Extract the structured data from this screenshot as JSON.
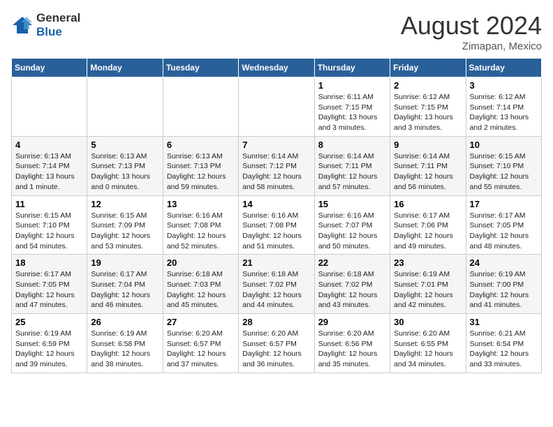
{
  "logo": {
    "text_general": "General",
    "text_blue": "Blue"
  },
  "title": {
    "month_year": "August 2024",
    "location": "Zimapan, Mexico"
  },
  "headers": [
    "Sunday",
    "Monday",
    "Tuesday",
    "Wednesday",
    "Thursday",
    "Friday",
    "Saturday"
  ],
  "weeks": [
    [
      {
        "day": "",
        "info": ""
      },
      {
        "day": "",
        "info": ""
      },
      {
        "day": "",
        "info": ""
      },
      {
        "day": "",
        "info": ""
      },
      {
        "day": "1",
        "info": "Sunrise: 6:11 AM\nSunset: 7:15 PM\nDaylight: 13 hours\nand 3 minutes."
      },
      {
        "day": "2",
        "info": "Sunrise: 6:12 AM\nSunset: 7:15 PM\nDaylight: 13 hours\nand 3 minutes."
      },
      {
        "day": "3",
        "info": "Sunrise: 6:12 AM\nSunset: 7:14 PM\nDaylight: 13 hours\nand 2 minutes."
      }
    ],
    [
      {
        "day": "4",
        "info": "Sunrise: 6:13 AM\nSunset: 7:14 PM\nDaylight: 13 hours\nand 1 minute."
      },
      {
        "day": "5",
        "info": "Sunrise: 6:13 AM\nSunset: 7:13 PM\nDaylight: 13 hours\nand 0 minutes."
      },
      {
        "day": "6",
        "info": "Sunrise: 6:13 AM\nSunset: 7:13 PM\nDaylight: 12 hours\nand 59 minutes."
      },
      {
        "day": "7",
        "info": "Sunrise: 6:14 AM\nSunset: 7:12 PM\nDaylight: 12 hours\nand 58 minutes."
      },
      {
        "day": "8",
        "info": "Sunrise: 6:14 AM\nSunset: 7:11 PM\nDaylight: 12 hours\nand 57 minutes."
      },
      {
        "day": "9",
        "info": "Sunrise: 6:14 AM\nSunset: 7:11 PM\nDaylight: 12 hours\nand 56 minutes."
      },
      {
        "day": "10",
        "info": "Sunrise: 6:15 AM\nSunset: 7:10 PM\nDaylight: 12 hours\nand 55 minutes."
      }
    ],
    [
      {
        "day": "11",
        "info": "Sunrise: 6:15 AM\nSunset: 7:10 PM\nDaylight: 12 hours\nand 54 minutes."
      },
      {
        "day": "12",
        "info": "Sunrise: 6:15 AM\nSunset: 7:09 PM\nDaylight: 12 hours\nand 53 minutes."
      },
      {
        "day": "13",
        "info": "Sunrise: 6:16 AM\nSunset: 7:08 PM\nDaylight: 12 hours\nand 52 minutes."
      },
      {
        "day": "14",
        "info": "Sunrise: 6:16 AM\nSunset: 7:08 PM\nDaylight: 12 hours\nand 51 minutes."
      },
      {
        "day": "15",
        "info": "Sunrise: 6:16 AM\nSunset: 7:07 PM\nDaylight: 12 hours\nand 50 minutes."
      },
      {
        "day": "16",
        "info": "Sunrise: 6:17 AM\nSunset: 7:06 PM\nDaylight: 12 hours\nand 49 minutes."
      },
      {
        "day": "17",
        "info": "Sunrise: 6:17 AM\nSunset: 7:05 PM\nDaylight: 12 hours\nand 48 minutes."
      }
    ],
    [
      {
        "day": "18",
        "info": "Sunrise: 6:17 AM\nSunset: 7:05 PM\nDaylight: 12 hours\nand 47 minutes."
      },
      {
        "day": "19",
        "info": "Sunrise: 6:17 AM\nSunset: 7:04 PM\nDaylight: 12 hours\nand 46 minutes."
      },
      {
        "day": "20",
        "info": "Sunrise: 6:18 AM\nSunset: 7:03 PM\nDaylight: 12 hours\nand 45 minutes."
      },
      {
        "day": "21",
        "info": "Sunrise: 6:18 AM\nSunset: 7:02 PM\nDaylight: 12 hours\nand 44 minutes."
      },
      {
        "day": "22",
        "info": "Sunrise: 6:18 AM\nSunset: 7:02 PM\nDaylight: 12 hours\nand 43 minutes."
      },
      {
        "day": "23",
        "info": "Sunrise: 6:19 AM\nSunset: 7:01 PM\nDaylight: 12 hours\nand 42 minutes."
      },
      {
        "day": "24",
        "info": "Sunrise: 6:19 AM\nSunset: 7:00 PM\nDaylight: 12 hours\nand 41 minutes."
      }
    ],
    [
      {
        "day": "25",
        "info": "Sunrise: 6:19 AM\nSunset: 6:59 PM\nDaylight: 12 hours\nand 39 minutes."
      },
      {
        "day": "26",
        "info": "Sunrise: 6:19 AM\nSunset: 6:58 PM\nDaylight: 12 hours\nand 38 minutes."
      },
      {
        "day": "27",
        "info": "Sunrise: 6:20 AM\nSunset: 6:57 PM\nDaylight: 12 hours\nand 37 minutes."
      },
      {
        "day": "28",
        "info": "Sunrise: 6:20 AM\nSunset: 6:57 PM\nDaylight: 12 hours\nand 36 minutes."
      },
      {
        "day": "29",
        "info": "Sunrise: 6:20 AM\nSunset: 6:56 PM\nDaylight: 12 hours\nand 35 minutes."
      },
      {
        "day": "30",
        "info": "Sunrise: 6:20 AM\nSunset: 6:55 PM\nDaylight: 12 hours\nand 34 minutes."
      },
      {
        "day": "31",
        "info": "Sunrise: 6:21 AM\nSunset: 6:54 PM\nDaylight: 12 hours\nand 33 minutes."
      }
    ]
  ]
}
